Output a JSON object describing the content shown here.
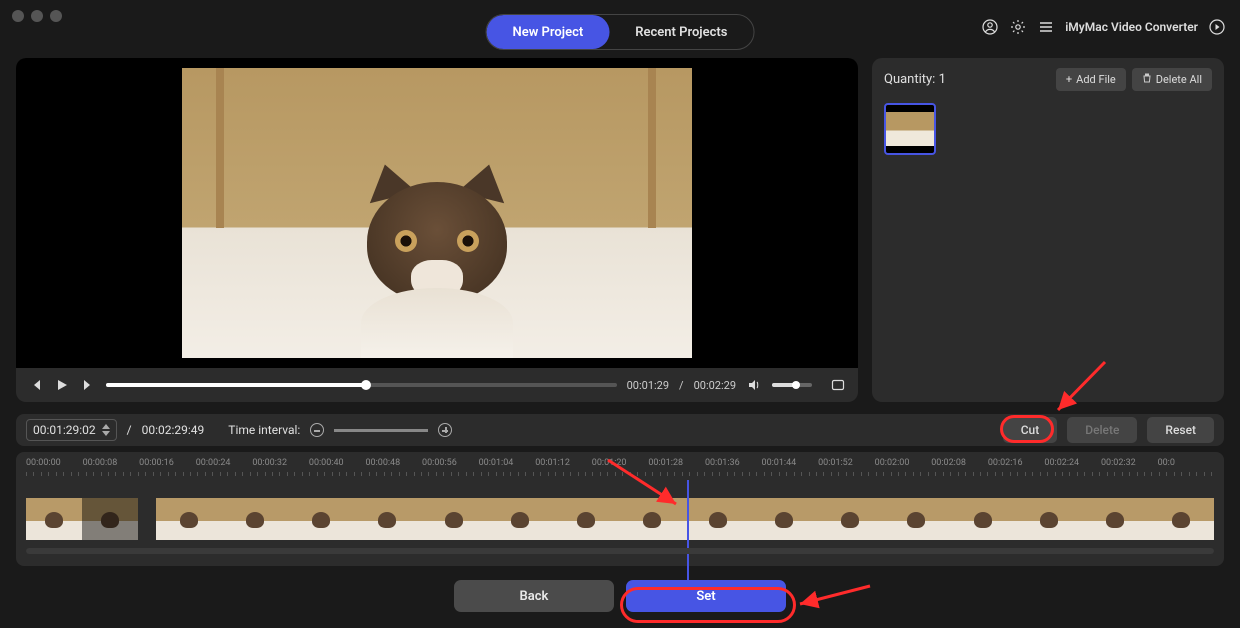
{
  "header": {
    "tabs": {
      "new_project": "New Project",
      "recent_projects": "Recent Projects"
    },
    "app_title": "iMyMac Video Converter"
  },
  "player": {
    "current_time": "00:01:29",
    "duration": "00:02:29"
  },
  "side": {
    "quantity_label": "Quantity:",
    "quantity_value": "1",
    "add_file": "Add File",
    "delete_all": "Delete All"
  },
  "trim": {
    "time_value": "00:01:29:02",
    "duration": "00:02:29:49",
    "interval_label": "Time interval:",
    "cut": "Cut",
    "delete": "Delete",
    "reset": "Reset"
  },
  "ruler": [
    "00:00:00",
    "00:00:08",
    "00:00:16",
    "00:00:24",
    "00:00:32",
    "00:00:40",
    "00:00:48",
    "00:00:56",
    "00:01:04",
    "00:01:12",
    "00:01:20",
    "00:01:28",
    "00:01:36",
    "00:01:44",
    "00:01:52",
    "00:02:00",
    "00:02:08",
    "00:02:16",
    "00:02:24",
    "00:02:32",
    "00:0"
  ],
  "footer": {
    "back": "Back",
    "set": "Set"
  }
}
